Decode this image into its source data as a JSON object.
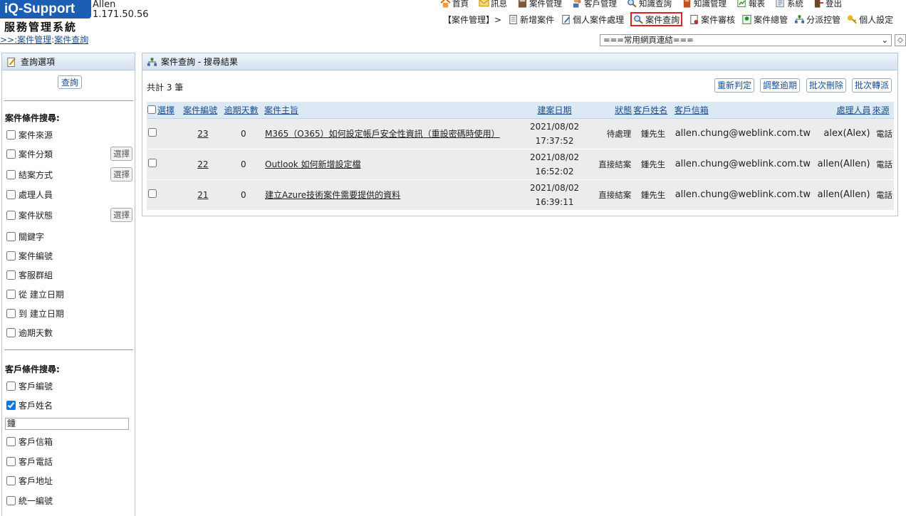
{
  "header": {
    "logo": "iQ-Support",
    "system_name": "服務管理系統",
    "user": "Allen",
    "ip": "1.171.50.56",
    "breadcrumb": {
      "prefix": ">>:",
      "module": "案件管理",
      "sep": ":",
      "page": "案件查詢"
    }
  },
  "top_menu": [
    "首頁",
    "訊息",
    "案件管理",
    "客戶管理",
    "知識查詢",
    "知識管理",
    "報表",
    "系統",
    "登出"
  ],
  "sub_menu": {
    "label": "【案件管理】>",
    "items": [
      "新增案件",
      "個人案件處理",
      "案件查詢",
      "案件審核",
      "案件總管",
      "分派控管",
      "個人設定"
    ],
    "active": "案件查詢"
  },
  "quick_links": {
    "value": "===常用網頁連結===",
    "button": "◇"
  },
  "left_panel": {
    "title": "查詢選項",
    "query_button": "查詢",
    "case_section": "案件條件搜尋:",
    "case_options": [
      {
        "label": "案件來源",
        "checked": false,
        "select": false
      },
      {
        "label": "案件分類",
        "checked": false,
        "select": true
      },
      {
        "label": "結案方式",
        "checked": false,
        "select": true
      },
      {
        "label": "處理人員",
        "checked": false,
        "select": false
      },
      {
        "label": "案件狀態",
        "checked": false,
        "select": true
      },
      {
        "label": "關鍵字",
        "checked": false,
        "select": false
      },
      {
        "label": "案件編號",
        "checked": false,
        "select": false
      },
      {
        "label": "客服群組",
        "checked": false,
        "select": false
      },
      {
        "label": "從 建立日期",
        "checked": false,
        "select": false
      },
      {
        "label": "到 建立日期",
        "checked": false,
        "select": false
      },
      {
        "label": "逾期天數",
        "checked": false,
        "select": false
      }
    ],
    "select_label": "選擇",
    "customer_section": "客戶條件搜尋:",
    "customer_options": [
      {
        "label": "客戶編號",
        "checked": false
      },
      {
        "label": "客戶姓名",
        "checked": true
      },
      {
        "label": "客戶信箱",
        "checked": false
      },
      {
        "label": "客戶電話",
        "checked": false
      },
      {
        "label": "客戶地址",
        "checked": false
      },
      {
        "label": "統一編號",
        "checked": false
      }
    ],
    "name_value": "鍾"
  },
  "results": {
    "title": "案件查詢 - 搜尋結果",
    "total": "共計 3 筆",
    "actions": [
      "重新判定",
      "調整逾期",
      "批次刪除",
      "批次轉派"
    ],
    "columns": [
      "選擇",
      "案件編號",
      "逾期天數",
      "案件主旨",
      "建案日期",
      "狀態",
      "客戶姓名",
      "客戶信箱",
      "處理人員",
      "來源"
    ],
    "rows": [
      {
        "id": "23",
        "overdue": "0",
        "subject": "M365（O365）如何設定帳戶安全性資訊（重設密碼時使用）",
        "date": "2021/08/02",
        "time": "17:37:52",
        "status": "待處理",
        "customer": "鍾先生",
        "email": "allen.chung@weblink.com.tw",
        "handler": "alex(Alex)",
        "source": "電話"
      },
      {
        "id": "22",
        "overdue": "0",
        "subject": "Outlook 如何新增設定檔",
        "date": "2021/08/02",
        "time": "16:52:02",
        "status": "直接結案",
        "customer": "鍾先生",
        "email": "allen.chung@weblink.com.tw",
        "handler": "allen(Allen)",
        "source": "電話"
      },
      {
        "id": "21",
        "overdue": "0",
        "subject": "建立Azure技術案件需要提供的資料",
        "date": "2021/08/02",
        "time": "16:39:11",
        "status": "直接結案",
        "customer": "鍾先生",
        "email": "allen.chung@weblink.com.tw",
        "handler": "allen(Allen)",
        "source": "電話"
      }
    ]
  }
}
